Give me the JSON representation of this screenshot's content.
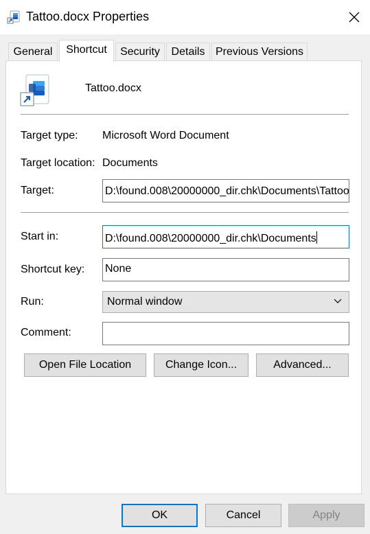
{
  "window": {
    "title": "Tattoo.docx Properties",
    "icon": "shortcut-document-icon",
    "close_icon": "close-icon"
  },
  "tabs": [
    {
      "label": "General",
      "active": false
    },
    {
      "label": "Shortcut",
      "active": true
    },
    {
      "label": "Security",
      "active": false
    },
    {
      "label": "Details",
      "active": false
    },
    {
      "label": "Previous Versions",
      "active": false
    }
  ],
  "shortcut": {
    "file_name": "Tattoo.docx",
    "target_type_label": "Target type:",
    "target_type_value": "Microsoft Word Document",
    "target_location_label": "Target location:",
    "target_location_value": "Documents",
    "target_label": "Target:",
    "target_value": "D:\\found.008\\20000000_dir.chk\\Documents\\Tattoo",
    "start_in_label": "Start in:",
    "start_in_value": "D:\\found.008\\20000000_dir.chk\\Documents",
    "shortcut_key_label": "Shortcut key:",
    "shortcut_key_value": "None",
    "run_label": "Run:",
    "run_value": "Normal window",
    "comment_label": "Comment:",
    "comment_value": ""
  },
  "action_buttons": {
    "open_file_location": "Open File Location",
    "change_icon": "Change Icon...",
    "advanced": "Advanced..."
  },
  "footer": {
    "ok": "OK",
    "cancel": "Cancel",
    "apply": "Apply"
  },
  "colors": {
    "accent": "#0078d7",
    "window_bg": "#f0f0f0",
    "panel_bg": "#ffffff"
  }
}
